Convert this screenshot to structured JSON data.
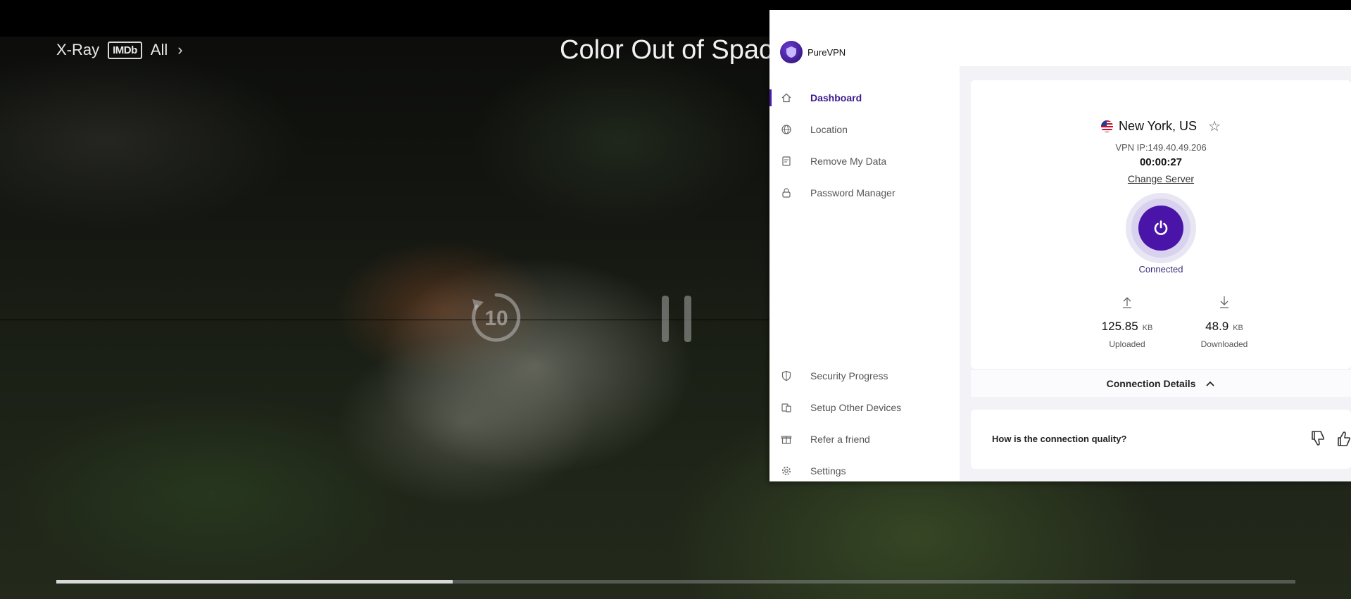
{
  "player": {
    "xray_label": "X-Ray",
    "imdb_label": "IMDb",
    "all_label": "All",
    "title": "Color Out of Spac",
    "rewind_seconds": "10",
    "progress_fraction": 0.32
  },
  "vpn": {
    "brand": "PureVPN",
    "nav_top": [
      {
        "label": "Dashboard",
        "icon": "home-icon",
        "active": true
      },
      {
        "label": "Location",
        "icon": "globe-icon"
      },
      {
        "label": "Remove My Data",
        "icon": "document-icon"
      },
      {
        "label": "Password Manager",
        "icon": "lock-icon"
      }
    ],
    "nav_bottom": [
      {
        "label": "Security Progress",
        "icon": "shield-icon"
      },
      {
        "label": "Setup Other Devices",
        "icon": "devices-icon"
      },
      {
        "label": "Refer a friend",
        "icon": "gift-icon"
      },
      {
        "label": "Settings",
        "icon": "gear-icon"
      }
    ],
    "location": "New York, US",
    "vpn_ip": "VPN IP:149.40.49.206",
    "timer": "00:00:27",
    "change_server": "Change Server",
    "status": "Connected",
    "uploaded": {
      "value": "125.85",
      "unit": "KB",
      "label": "Uploaded"
    },
    "downloaded": {
      "value": "48.9",
      "unit": "KB",
      "label": "Downloaded"
    },
    "connection_details": "Connection Details",
    "quality_question": "How is the connection quality?",
    "colors": {
      "accent": "#4a14a8",
      "accent_light": "#e9e6f4"
    }
  }
}
